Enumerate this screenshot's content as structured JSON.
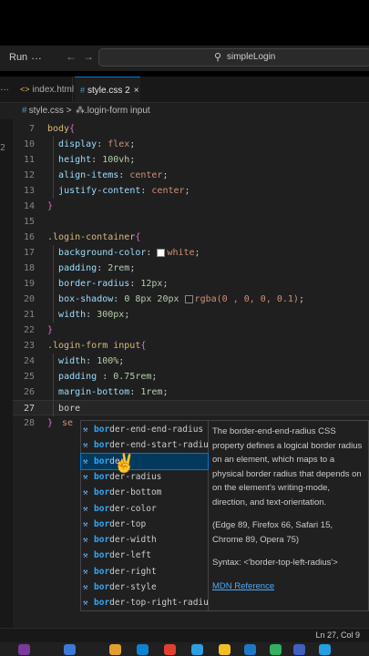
{
  "titlebar": {
    "run_label": "Run",
    "more_label": "…",
    "back_icon": "←",
    "forward_icon": "→",
    "search_text": "simpleLogin",
    "search_icon": "search-icon"
  },
  "tabs": {
    "overflow_label": "…",
    "items": [
      {
        "icon": "<>",
        "label": "index.html"
      },
      {
        "icon": "#",
        "label": "style.css 2",
        "close": "×"
      }
    ]
  },
  "breadcrumb": {
    "file": "style.css",
    "separator": ">",
    "symbol": ".login-form input"
  },
  "gutter_left_labels": [
    "2"
  ],
  "code_lines": [
    {
      "num": "7",
      "text": "body{"
    },
    {
      "num": "10",
      "prop": "display",
      "value": "flex"
    },
    {
      "num": "11",
      "prop": "height",
      "value": "100vh"
    },
    {
      "num": "12",
      "prop": "align-items",
      "value": "center"
    },
    {
      "num": "13",
      "prop": "justify-content",
      "value": "center"
    },
    {
      "num": "14",
      "text": "}"
    },
    {
      "num": "15",
      "text": ""
    },
    {
      "num": "16",
      "text": ".login-container{"
    },
    {
      "num": "17",
      "prop": "background-color",
      "value": "white"
    },
    {
      "num": "18",
      "prop": "padding",
      "value": "2rem"
    },
    {
      "num": "19",
      "prop": "border-radius",
      "value": "12px"
    },
    {
      "num": "20",
      "prop": "box-shadow",
      "value": "0 8px 20px rgba(0 , 0, 0, 0.1)"
    },
    {
      "num": "21",
      "prop": "width",
      "value": "300px"
    },
    {
      "num": "22",
      "text": "}"
    },
    {
      "num": "23",
      "text": ".login-form input{"
    },
    {
      "num": "24",
      "prop": "width",
      "value": "100%"
    },
    {
      "num": "25",
      "prop": "padding ",
      "value": "0.75rem"
    },
    {
      "num": "26",
      "prop": "margin-bottom",
      "value": "1rem"
    },
    {
      "num": "27",
      "typed": "bore"
    },
    {
      "num": "28",
      "text": "}",
      "partial": "se"
    }
  ],
  "suggestions": [
    {
      "pre": "bor",
      "hl": "de",
      "post": "r-end-end-radius"
    },
    {
      "pre": "bor",
      "hl": "de",
      "post": "r-end-start-radius"
    },
    {
      "pre": "bor",
      "hl": "de",
      "post": "r"
    },
    {
      "pre": "bor",
      "hl": "de",
      "post": "r-radius"
    },
    {
      "pre": "bor",
      "hl": "de",
      "post": "r-bottom"
    },
    {
      "pre": "bor",
      "hl": "de",
      "post": "r-color"
    },
    {
      "pre": "bor",
      "hl": "de",
      "post": "r-top"
    },
    {
      "pre": "bor",
      "hl": "de",
      "post": "r-width"
    },
    {
      "pre": "bor",
      "hl": "de",
      "post": "r-left"
    },
    {
      "pre": "bor",
      "hl": "de",
      "post": "r-right"
    },
    {
      "pre": "bor",
      "hl": "de",
      "post": "r-style"
    },
    {
      "pre": "bor",
      "hl": "de",
      "post": "r-top-right-radius"
    }
  ],
  "details": {
    "description": "The border-end-end-radius CSS property defines a logical border radius on an element, which maps to a physical border radius that depends on on the element's writing-mode, direction, and text-orientation.",
    "compat": "(Edge 89, Firefox 66, Safari 15, Chrome 89, Opera 75)",
    "syntax": "Syntax: <'border-top-left-radius'>",
    "link": "MDN Reference"
  },
  "statusbar": {
    "position": "Ln 27, Col 9"
  },
  "colors": {
    "editor_bg": "#1f1f1f",
    "selector": "#d7ba7d",
    "property": "#9cdcfe",
    "value": "#ce9178",
    "number": "#b5cea8",
    "match_highlight": "#2aaaff",
    "accent": "#0078d4"
  }
}
